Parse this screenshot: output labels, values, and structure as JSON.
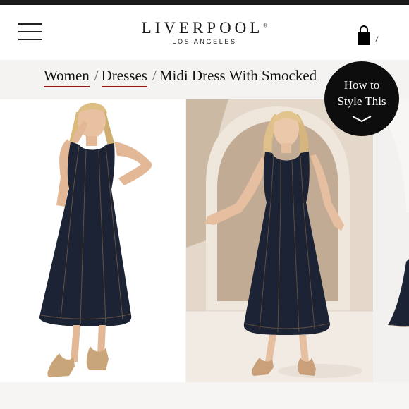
{
  "brand": {
    "name": "LIVERPOOL",
    "trademark": "®",
    "location": "LOS ANGELES"
  },
  "header": {
    "menu_icon": "hamburger-menu-icon",
    "bag_icon": "shopping-bag-icon",
    "bag_count": "/"
  },
  "breadcrumbs": {
    "separator": "/",
    "items": [
      {
        "label": "Women"
      },
      {
        "label": "Dresses"
      }
    ],
    "current": "Midi Dress With Smocked"
  },
  "style_button": {
    "line1": "How to",
    "line2": "Style This",
    "icon": "chevron-down-icon"
  },
  "gallery": [
    {
      "name": "product-image-front-white-background"
    },
    {
      "name": "product-image-lifestyle-arched-room"
    },
    {
      "name": "product-image-partial-next"
    }
  ],
  "colors": {
    "accent_underline": "#8b1a1a",
    "dress": "#1c2334",
    "button_bg": "#0d0d0d"
  }
}
